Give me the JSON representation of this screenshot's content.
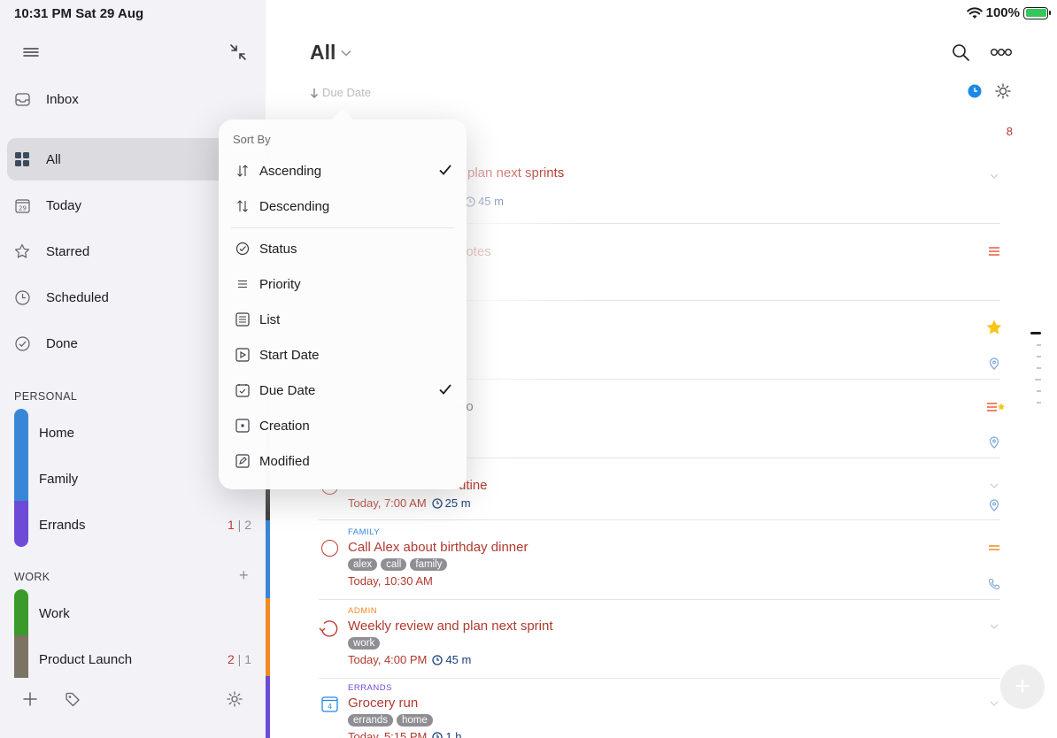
{
  "status_bar": {
    "time": "10:31 PM  Sat 29 Aug",
    "battery": "100%"
  },
  "sidebar": {
    "nav": [
      {
        "label": "Inbox",
        "icon": "inbox-icon"
      },
      {
        "label": "All",
        "icon": "grid-icon"
      },
      {
        "label": "Today",
        "icon": "calendar-icon",
        "day": "29"
      },
      {
        "label": "Starred",
        "icon": "star-icon"
      },
      {
        "label": "Scheduled",
        "icon": "clock-icon"
      },
      {
        "label": "Done",
        "icon": "check-circle-icon"
      }
    ],
    "personal_header": "PERSONAL",
    "personal_lists": [
      {
        "label": "Home",
        "color": "#3a86d6"
      },
      {
        "label": "Family",
        "color": "#3a86d6"
      },
      {
        "label": "Errands",
        "color": "#6e4bd6",
        "count_a": "1",
        "count_b": "2"
      }
    ],
    "work_header": "WORK",
    "work_lists": [
      {
        "label": "Work",
        "color": "#3c9a2a"
      },
      {
        "label": "Product Launch",
        "color": "#7b7363",
        "count_a": "2",
        "count_b": "1"
      }
    ]
  },
  "main": {
    "title": "All",
    "sort_label": "Due Date",
    "count_badge": "8",
    "tasks": [
      {
        "area": "",
        "title": "plan next sprints",
        "tags": [],
        "date": "",
        "duration": "45 m"
      },
      {
        "area": "",
        "title": "notes",
        "tags": [],
        "date": "",
        "duration": ""
      },
      {
        "area": "",
        "title": "",
        "tags": [],
        "date": "",
        "duration": ""
      },
      {
        "area": "",
        "title": "eo",
        "tags": [],
        "date": "",
        "duration": ""
      },
      {
        "area": "",
        "title": "utine",
        "tags": [],
        "date": "Today, 7:00 AM",
        "duration": "25 m"
      },
      {
        "area": "FAMILY",
        "area_color": "#3a86d6",
        "title": "Call Alex about birthday dinner",
        "tags": [
          "alex",
          "call",
          "family"
        ],
        "date": "Today, 10:30 AM",
        "duration": ""
      },
      {
        "area": "ADMIN",
        "area_color": "#f08a24",
        "title": "Weekly review and plan next sprint",
        "tags": [
          "work"
        ],
        "date": "Today, 4:00 PM",
        "duration": "45 m"
      },
      {
        "area": "ERRANDS",
        "area_color": "#6e4bd6",
        "title": "Grocery run",
        "tags": [
          "errands",
          "home"
        ],
        "date": "Today, 5:15 PM",
        "duration": "1 h"
      }
    ]
  },
  "popover": {
    "header": "Sort By",
    "items": [
      {
        "label": "Ascending",
        "icon": "sort-icon",
        "checked": true
      },
      {
        "label": "Descending",
        "icon": "sort-icon",
        "checked": false
      },
      {
        "label": "Status",
        "icon": "status-icon",
        "checked": false
      },
      {
        "label": "Priority",
        "icon": "priority-icon",
        "checked": false
      },
      {
        "label": "List",
        "icon": "list-icon",
        "checked": false
      },
      {
        "label": "Start Date",
        "icon": "start-date-icon",
        "checked": false
      },
      {
        "label": "Due Date",
        "icon": "due-date-icon",
        "checked": true
      },
      {
        "label": "Creation",
        "icon": "creation-icon",
        "checked": false
      },
      {
        "label": "Modified",
        "icon": "modified-icon",
        "checked": false
      }
    ]
  }
}
